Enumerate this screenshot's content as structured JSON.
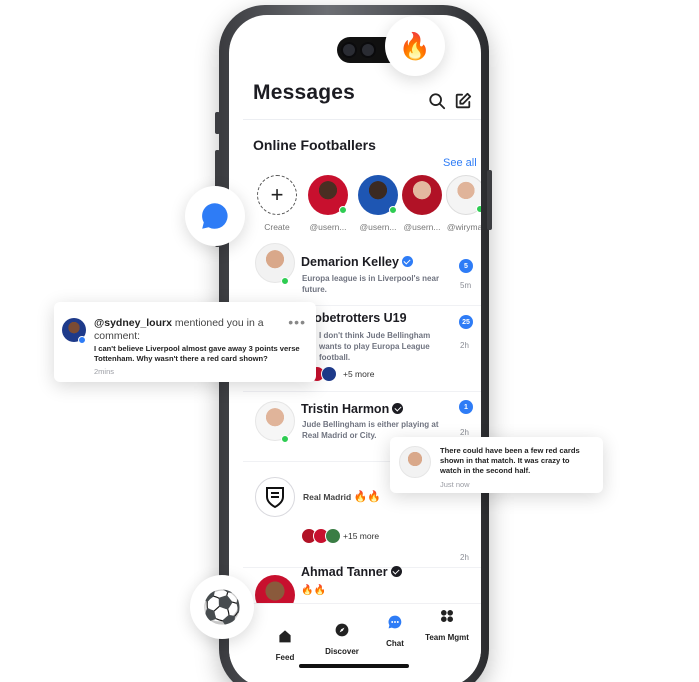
{
  "messages": {
    "title": "Messages",
    "icons": [
      "search-icon",
      "compose-icon"
    ]
  },
  "online": {
    "title": "Online Footballers",
    "see_all": "See all",
    "create_label": "Create",
    "stories": [
      {
        "label": "@usern...",
        "online": true
      },
      {
        "label": "@usern...",
        "online": true
      },
      {
        "label": "@usern...",
        "online": false
      },
      {
        "label": "@wirymar",
        "online": true
      }
    ]
  },
  "conversations": [
    {
      "name": "Demarion Kelley",
      "verified": "blue",
      "preview": "Europa league is in Liverpool's near future.",
      "badge": "5",
      "time": "5m"
    },
    {
      "name": "Globetrotters U19",
      "preview": "I don't think Jude Bellingham wants to play Europa League football.",
      "badge": "25",
      "time": "2h",
      "more": "+5 more"
    },
    {
      "name": "Tristin Harmon",
      "verified": "black",
      "preview": "Jude Bellingham is either playing at Real Madrid or City.",
      "badge": "1",
      "time": "2h"
    },
    {
      "name": "Real Madrid",
      "emoji": "🔥🔥",
      "time": "2h",
      "more": "+15 more"
    },
    {
      "name": "Ahmad Tanner",
      "verified": "black",
      "emoji": "🔥🔥"
    }
  ],
  "tabs": [
    {
      "label": "Feed",
      "icon": "home-icon"
    },
    {
      "label": "Discover",
      "icon": "compass-icon"
    },
    {
      "label": "Chat",
      "icon": "chat-icon",
      "active": true
    },
    {
      "label": "Team Mgmt",
      "icon": "team-icon"
    }
  ],
  "mention_card": {
    "user": "@sydney_lourx",
    "action": "mentioned you in a comment:",
    "text": "I can't believe Liverpool almost gave away 3 points verse Tottenham. Why wasn't there a red card shown?",
    "time": "2mins",
    "menu_icon": "more-dots-icon"
  },
  "reply_card": {
    "text": "There could have been a few red cards shown in that match. It was crazy to watch in the second half.",
    "time": "Just now"
  },
  "floating": {
    "fire": "🔥",
    "ball": "⚽",
    "chat_icon": "chat-bubble-icon"
  },
  "colors": {
    "accent": "#2e7cf6",
    "online": "#2ecc52",
    "red_kit": "#c8102e"
  }
}
